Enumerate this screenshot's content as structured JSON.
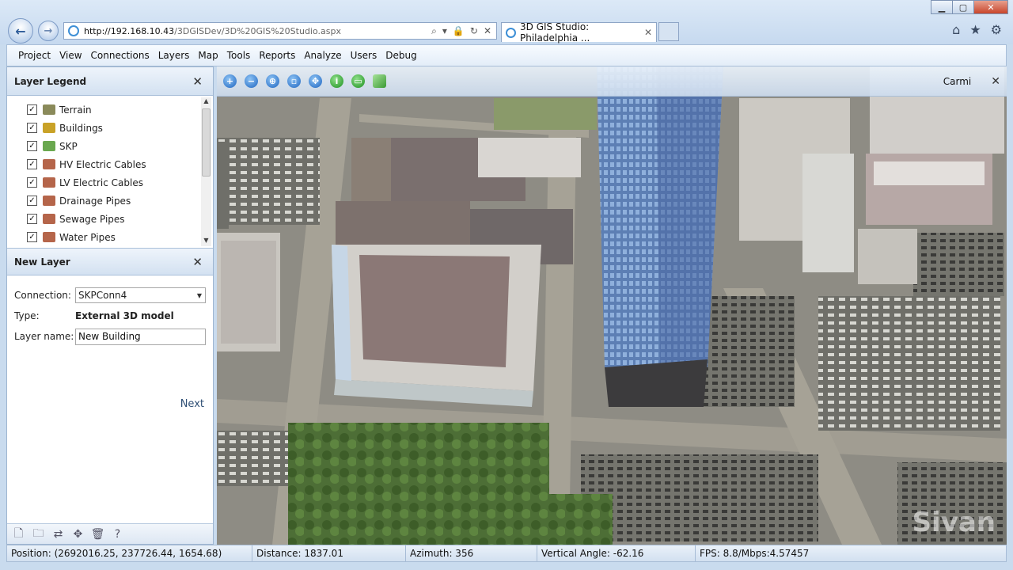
{
  "browser": {
    "url_host": "http://192.168.10.43",
    "url_path": "/3DGISDev/3D%20GIS%20Studio.aspx",
    "tab_title": "3D GIS Studio: Philadelphia ..."
  },
  "menu": [
    "Project",
    "View",
    "Connections",
    "Layers",
    "Map",
    "Tools",
    "Reports",
    "Analyze",
    "Users",
    "Debug"
  ],
  "legend": {
    "title": "Layer Legend",
    "items": [
      {
        "label": "Terrain",
        "checked": true,
        "color": "#8a8a5a"
      },
      {
        "label": "Buildings",
        "checked": true,
        "color": "#c9a227"
      },
      {
        "label": "SKP",
        "checked": true,
        "color": "#6aa84f"
      },
      {
        "label": "HV Electric Cables",
        "checked": true,
        "color": "#b5654a"
      },
      {
        "label": "LV Electric Cables",
        "checked": true,
        "color": "#b5654a"
      },
      {
        "label": "Drainage Pipes",
        "checked": true,
        "color": "#b5654a"
      },
      {
        "label": "Sewage Pipes",
        "checked": true,
        "color": "#b5654a"
      },
      {
        "label": "Water Pipes",
        "checked": true,
        "color": "#b5654a"
      }
    ]
  },
  "new_layer": {
    "title": "New Layer",
    "connection_label": "Connection:",
    "connection_value": "SKPConn4",
    "type_label": "Type:",
    "type_value": "External 3D model",
    "layer_name_label": "Layer name:",
    "layer_name_value": "New Building",
    "next_label": "Next"
  },
  "map": {
    "user": "Carmi",
    "watermark": "Sivan"
  },
  "status": {
    "position": "Position: (2692016.25, 237726.44, 1654.68)",
    "distance": "Distance: 1837.01",
    "azimuth": "Azimuth: 356",
    "vertical_angle": "Vertical Angle: -62.16",
    "fps": "FPS: 8.8/Mbps:4.57457"
  }
}
